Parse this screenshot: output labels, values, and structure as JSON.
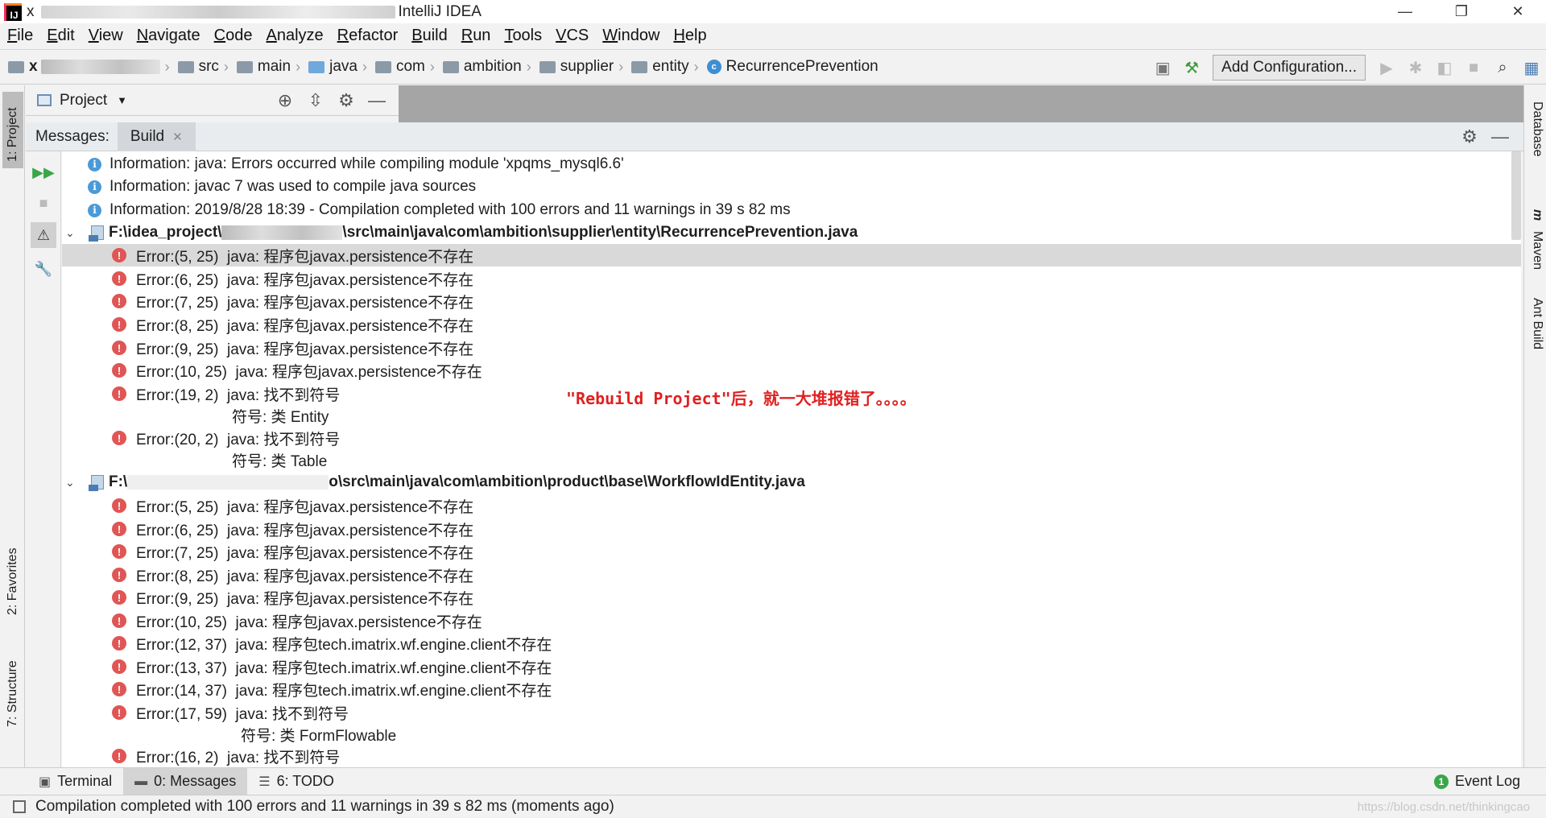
{
  "window": {
    "app_name": "IntelliJ IDEA",
    "title_prefix": "x",
    "controls": {
      "minimize": "—",
      "restore": "❐",
      "close": "✕"
    }
  },
  "menu": [
    "File",
    "Edit",
    "View",
    "Navigate",
    "Code",
    "Analyze",
    "Refactor",
    "Build",
    "Run",
    "Tools",
    "VCS",
    "Window",
    "Help"
  ],
  "navbar": {
    "project_prefix": "x",
    "crumbs": [
      "src",
      "main",
      "java",
      "com",
      "ambition",
      "supplier",
      "entity"
    ],
    "current_class": "RecurrencePrevention",
    "class_icon_letter": "c",
    "add_configuration": "Add Configuration..."
  },
  "left_tabs": {
    "project": "1: Project",
    "favorites": "2: Favorites",
    "structure": "7: Structure"
  },
  "right_tabs": {
    "database": "Database",
    "maven": "Maven",
    "ant": "Ant Build",
    "maven_icon": "m"
  },
  "project_panel": {
    "label": "Project"
  },
  "messages": {
    "label": "Messages:",
    "tab": "Build",
    "rows": [
      {
        "type": "info",
        "text": "Information: java: Errors occurred while compiling module 'xpqms_mysql6.6'"
      },
      {
        "type": "info",
        "text": "Information: javac 7 was used to compile java sources"
      },
      {
        "type": "info",
        "text": "Information: 2019/8/28 18:39 - Compilation completed with 100 errors and 11 warnings in 39 s 82 ms"
      },
      {
        "type": "file",
        "prefix": "F:\\idea_project\\",
        "suffix": "\\src\\main\\java\\com\\ambition\\supplier\\entity\\RecurrencePrevention.java"
      },
      {
        "type": "error",
        "text": "Error:(5, 25)  java: 程序包javax.persistence不存在",
        "selected": true
      },
      {
        "type": "error",
        "text": "Error:(6, 25)  java: 程序包javax.persistence不存在"
      },
      {
        "type": "error",
        "text": "Error:(7, 25)  java: 程序包javax.persistence不存在"
      },
      {
        "type": "error",
        "text": "Error:(8, 25)  java: 程序包javax.persistence不存在"
      },
      {
        "type": "error",
        "text": "Error:(9, 25)  java: 程序包javax.persistence不存在"
      },
      {
        "type": "error",
        "text": "Error:(10, 25)  java: 程序包javax.persistence不存在"
      },
      {
        "type": "error",
        "text": "Error:(19, 2)  java: 找不到符号"
      },
      {
        "type": "detail",
        "text": "符号: 类 Entity"
      },
      {
        "type": "error",
        "text": "Error:(20, 2)  java: 找不到符号"
      },
      {
        "type": "detail",
        "text": "符号: 类 Table"
      },
      {
        "type": "file",
        "prefix": "F:\\",
        "suffix": "o\\src\\main\\java\\com\\ambition\\product\\base\\WorkflowIdEntity.java"
      },
      {
        "type": "error",
        "text": "Error:(5, 25)  java: 程序包javax.persistence不存在"
      },
      {
        "type": "error",
        "text": "Error:(6, 25)  java: 程序包javax.persistence不存在"
      },
      {
        "type": "error",
        "text": "Error:(7, 25)  java: 程序包javax.persistence不存在"
      },
      {
        "type": "error",
        "text": "Error:(8, 25)  java: 程序包javax.persistence不存在"
      },
      {
        "type": "error",
        "text": "Error:(9, 25)  java: 程序包javax.persistence不存在"
      },
      {
        "type": "error",
        "text": "Error:(10, 25)  java: 程序包javax.persistence不存在"
      },
      {
        "type": "error",
        "text": "Error:(12, 37)  java: 程序包tech.imatrix.wf.engine.client不存在"
      },
      {
        "type": "error",
        "text": "Error:(13, 37)  java: 程序包tech.imatrix.wf.engine.client不存在"
      },
      {
        "type": "error",
        "text": "Error:(14, 37)  java: 程序包tech.imatrix.wf.engine.client不存在"
      },
      {
        "type": "error",
        "text": "Error:(17, 59)  java: 找不到符号"
      },
      {
        "type": "detail",
        "text": "符号: 类 FormFlowable",
        "wide": true
      },
      {
        "type": "error",
        "text": "Error:(16, 2)  java: 找不到符号"
      }
    ],
    "annotation": "\"Rebuild Project\"后，就一大堆报错了。。。。"
  },
  "bottom_tabs": [
    {
      "label": "Terminal",
      "icon": "▣"
    },
    {
      "label": "0: Messages",
      "icon": "▬",
      "active": true
    },
    {
      "label": "6: TODO",
      "icon": "☰"
    }
  ],
  "event_log": {
    "label": "Event Log",
    "count": "1"
  },
  "status": {
    "text": "Compilation completed with 100 errors and 11 warnings in 39 s 82 ms (moments ago)",
    "watermark": "https://blog.csdn.net/thinkingcao"
  }
}
